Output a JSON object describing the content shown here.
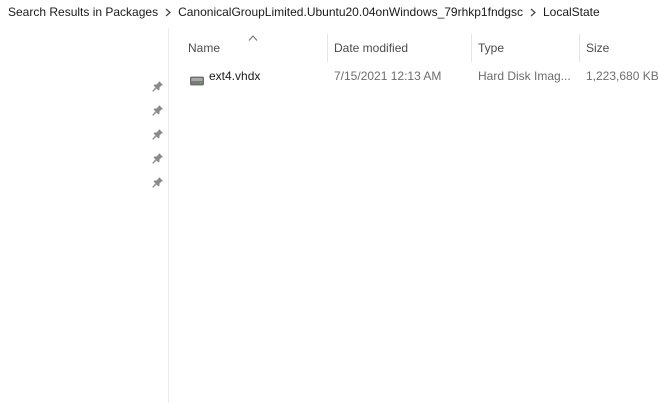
{
  "breadcrumb": {
    "items": [
      "Search Results in Packages",
      "CanonicalGroupLimited.Ubuntu20.04onWindows_79rhkp1fndgsc",
      "LocalState"
    ]
  },
  "nav_pane": {
    "pinned_icons": [
      "pin-icon",
      "pin-icon",
      "pin-icon",
      "pin-icon",
      "pin-icon"
    ]
  },
  "file_list": {
    "sort": {
      "column": "Name",
      "direction": "ascending"
    },
    "columns": {
      "name": "Name",
      "date_modified": "Date modified",
      "type": "Type",
      "size": "Size"
    },
    "rows": [
      {
        "name": "ext4.vhdx",
        "date_modified": "7/15/2021 12:13 AM",
        "type": "Hard Disk Imag...",
        "size": "1,223,680 KB",
        "icon": "virtual-disk-icon"
      }
    ]
  }
}
